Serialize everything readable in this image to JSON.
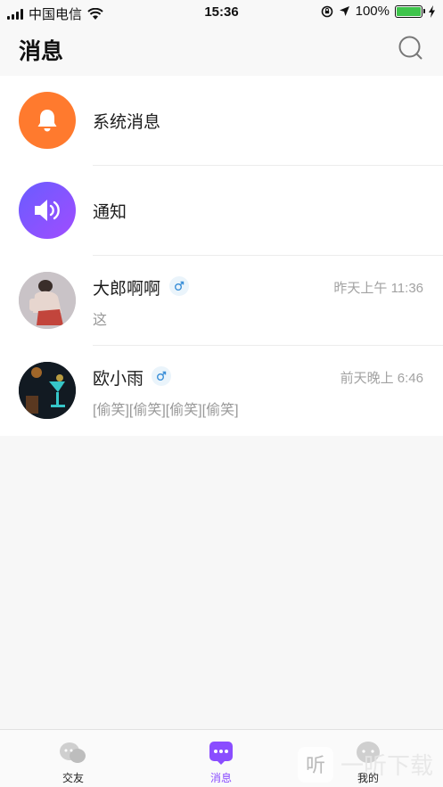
{
  "status_bar": {
    "carrier": "中国电信",
    "time": "15:36",
    "battery": "100%"
  },
  "header": {
    "title": "消息",
    "search_icon": "search-icon"
  },
  "messages": [
    {
      "title": "系统消息",
      "icon": "bell-icon",
      "color": "#ff7a2e"
    },
    {
      "title": "通知",
      "icon": "speaker-icon",
      "color": "#8a4dff"
    },
    {
      "title": "大郎啊啊",
      "gender": "male",
      "time": "昨天上午 11:36",
      "preview": "这"
    },
    {
      "title": "欧小雨",
      "gender": "male",
      "time": "前天晚上 6:46",
      "preview": "[偷笑][偷笑][偷笑][偷笑]"
    }
  ],
  "tabs": [
    {
      "label": "交友",
      "icon": "chat-bubbles-icon",
      "active": false
    },
    {
      "label": "消息",
      "icon": "message-icon",
      "active": true
    },
    {
      "label": "我的",
      "icon": "profile-icon",
      "active": false
    }
  ],
  "colors": {
    "accent": "#8a4dff",
    "orange": "#ff7a2e",
    "gender_blue": "#3b8fd8"
  },
  "watermark": "一听下载"
}
